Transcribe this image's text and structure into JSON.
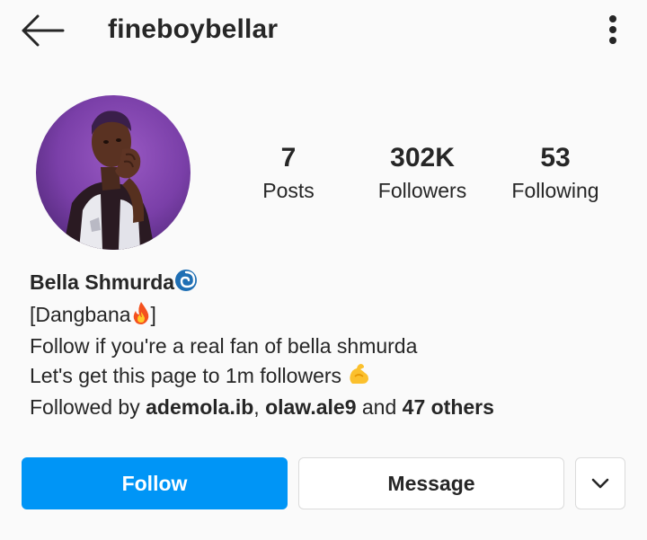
{
  "header": {
    "username": "fineboybellar",
    "back_icon": "arrow-left-icon",
    "more_icon": "more-vertical-icon"
  },
  "profile": {
    "avatar": "profile-photo",
    "stats": {
      "posts": {
        "value": "7",
        "label": "Posts"
      },
      "followers": {
        "value": "302K",
        "label": "Followers"
      },
      "following": {
        "value": "53",
        "label": "Following"
      }
    },
    "bio": {
      "name": "Bella Shmurda",
      "name_emoji": "cyclone-icon",
      "tag_open": "[Dangbana",
      "tag_emoji": "fire-icon",
      "tag_close": "]",
      "line2": "Follow if you're a real fan of bella shmurda",
      "line3": "Let's get this page to 1m followers ",
      "line3_emoji": "flexed-biceps-icon",
      "followed_by_prefix": "Followed by ",
      "mutual_1": "ademola.ib",
      "separator": ", ",
      "mutual_2": "olaw.ale9",
      "and_text": " and ",
      "others": "47 others"
    }
  },
  "actions": {
    "follow_label": "Follow",
    "message_label": "Message",
    "suggest_icon": "chevron-down-icon"
  },
  "colors": {
    "accent": "#0095f6",
    "background": "#fafafa",
    "text": "#262626",
    "border": "#dbdbdb"
  }
}
